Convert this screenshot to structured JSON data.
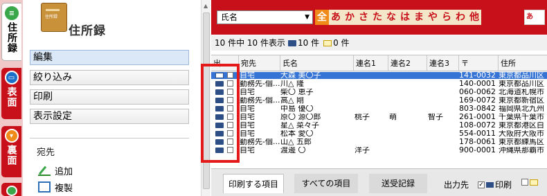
{
  "sidebar_tabs": [
    {
      "label": "住所録",
      "icon": "address-book-tab-icon"
    },
    {
      "label": "表面",
      "icon": "front-side-tab-icon"
    },
    {
      "label": "裏面",
      "icon": "back-side-tab-icon"
    }
  ],
  "left_panel": {
    "title": "住所録",
    "book_label": "住所録",
    "menu": [
      {
        "label": "編集",
        "active": true
      },
      {
        "label": "絞り込み",
        "active": false
      },
      {
        "label": "印刷",
        "active": false
      },
      {
        "label": "表示設定",
        "active": false
      }
    ],
    "section_label": "宛先",
    "actions": [
      {
        "label": "追加",
        "icon": "pencil-icon"
      },
      {
        "label": "複製",
        "icon": "copy-icon"
      }
    ]
  },
  "toolbar": {
    "group_select": "氏名",
    "kana_filters": [
      "全",
      "あ",
      "か",
      "さ",
      "た",
      "な",
      "は",
      "ま",
      "や",
      "ら",
      "わ",
      "他"
    ],
    "kana_selected": "全",
    "sort_button": "あ→A"
  },
  "status": {
    "count_text": "10 件中 10 件表示",
    "print_count": "10 件",
    "mail_count": "0 件"
  },
  "table": {
    "columns": [
      "出...",
      "宛先",
      "氏名",
      "連名1",
      "連名2",
      "連名3",
      "〒",
      "住所"
    ],
    "rows": [
      {
        "dest": "自宅",
        "name": "大森 美〇子",
        "n1": "",
        "n2": "",
        "n3": "",
        "zip": "141-0032",
        "addr": "東京都品川区",
        "selected": true
      },
      {
        "dest": "勤務先-個...",
        "name": "川△ 隆",
        "n1": "",
        "n2": "",
        "n3": "",
        "zip": "140-0001",
        "addr": "東京都品川区",
        "selected": false
      },
      {
        "dest": "自宅",
        "name": "柴〇 恵子",
        "n1": "",
        "n2": "",
        "n3": "",
        "zip": "060-0062",
        "addr": "北海道札幌市",
        "selected": false
      },
      {
        "dest": "勤務先-個...",
        "name": "高△ 剛",
        "n1": "",
        "n2": "",
        "n3": "",
        "zip": "169-0072",
        "addr": "東京都新宿区",
        "selected": false
      },
      {
        "dest": "自宅",
        "name": "中島 優〇",
        "n1": "",
        "n2": "",
        "n3": "",
        "zip": "803-0842",
        "addr": "福岡県北九州",
        "selected": false
      },
      {
        "dest": "自宅",
        "name": "原〇 源〇郎",
        "n1": "桃子",
        "n2": "萌",
        "n3": "智子",
        "zip": "261-0001",
        "addr": "千葉県千葉市",
        "selected": false
      },
      {
        "dest": "自宅",
        "name": "星△ 菜々子",
        "n1": "",
        "n2": "",
        "n3": "",
        "zip": "108-0072",
        "addr": "東京都港区白",
        "selected": false
      },
      {
        "dest": "自宅",
        "name": "松本 愛〇",
        "n1": "",
        "n2": "",
        "n3": "",
        "zip": "554-0011",
        "addr": "大阪府大阪市",
        "selected": false
      },
      {
        "dest": "勤務先-個...",
        "name": "山△ 五郎",
        "n1": "",
        "n2": "",
        "n3": "",
        "zip": "178-0061",
        "addr": "東京都練馬区",
        "selected": false
      },
      {
        "dest": "自宅",
        "name": "渡邊 〇",
        "n1": "洋子",
        "n2": "",
        "n3": "",
        "zip": "900-0001",
        "addr": "沖縄県那覇市",
        "selected": false
      }
    ]
  },
  "bottom_tabs": [
    "印刷する項目",
    "すべての項目",
    "送受記録"
  ],
  "output": {
    "label": "出力先",
    "print_label": "印刷"
  },
  "colors": {
    "brand_red": "#c8101a",
    "kana_active": "#f08a18",
    "selection_blue": "#3574d4",
    "annotation_red": "#e41a1a"
  }
}
